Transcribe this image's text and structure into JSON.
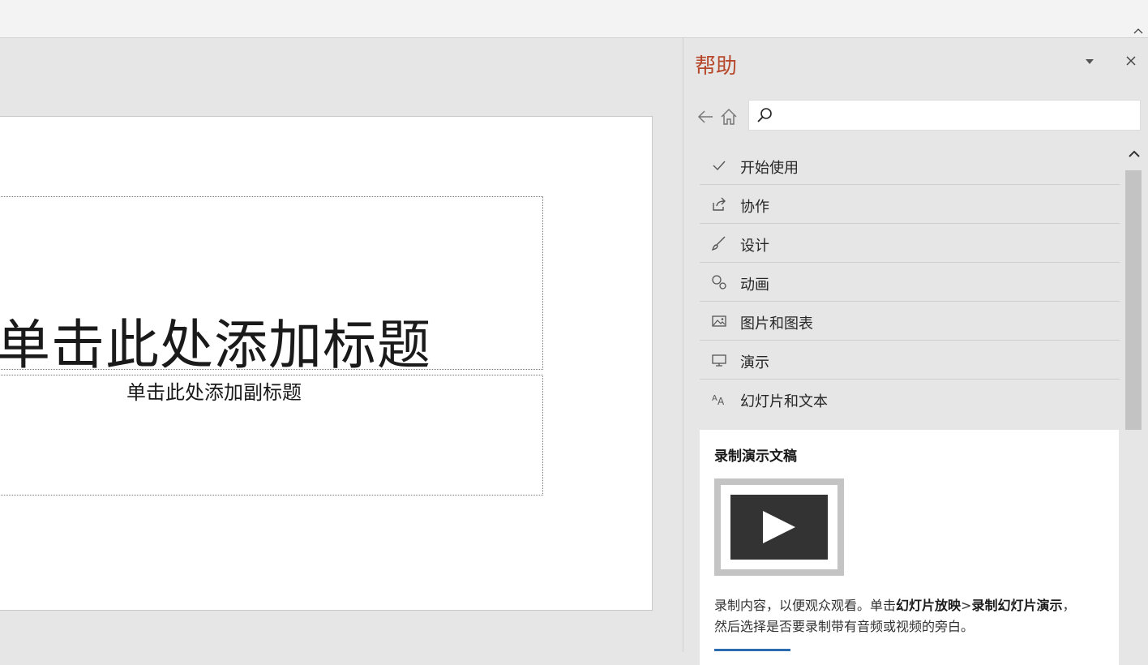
{
  "slide": {
    "title_placeholder": "单击此处添加标题",
    "subtitle_placeholder": "单击此处添加副标题"
  },
  "help_pane": {
    "title": "帮助",
    "search": {
      "placeholder": ""
    },
    "categories": [
      {
        "label": "开始使用",
        "icon": "checkmark-icon"
      },
      {
        "label": "协作",
        "icon": "share-icon"
      },
      {
        "label": "设计",
        "icon": "brush-icon"
      },
      {
        "label": "动画",
        "icon": "animation-icon"
      },
      {
        "label": "图片和图表",
        "icon": "picture-icon"
      },
      {
        "label": "演示",
        "icon": "monitor-icon"
      },
      {
        "label": "幻灯片和文本",
        "icon": "text-size-icon"
      }
    ],
    "card": {
      "title": "录制演示文稿",
      "desc_part1": "录制内容，以便观众观看。单击",
      "desc_bold1": "幻灯片放映",
      "desc_sep": ">",
      "desc_bold2": "录制幻灯片演示",
      "desc_part2": "，然后选择是否要录制带有音频或视频的旁白。"
    }
  },
  "colors": {
    "pane_title": "#b7472a",
    "background": "#e6e6e6"
  }
}
